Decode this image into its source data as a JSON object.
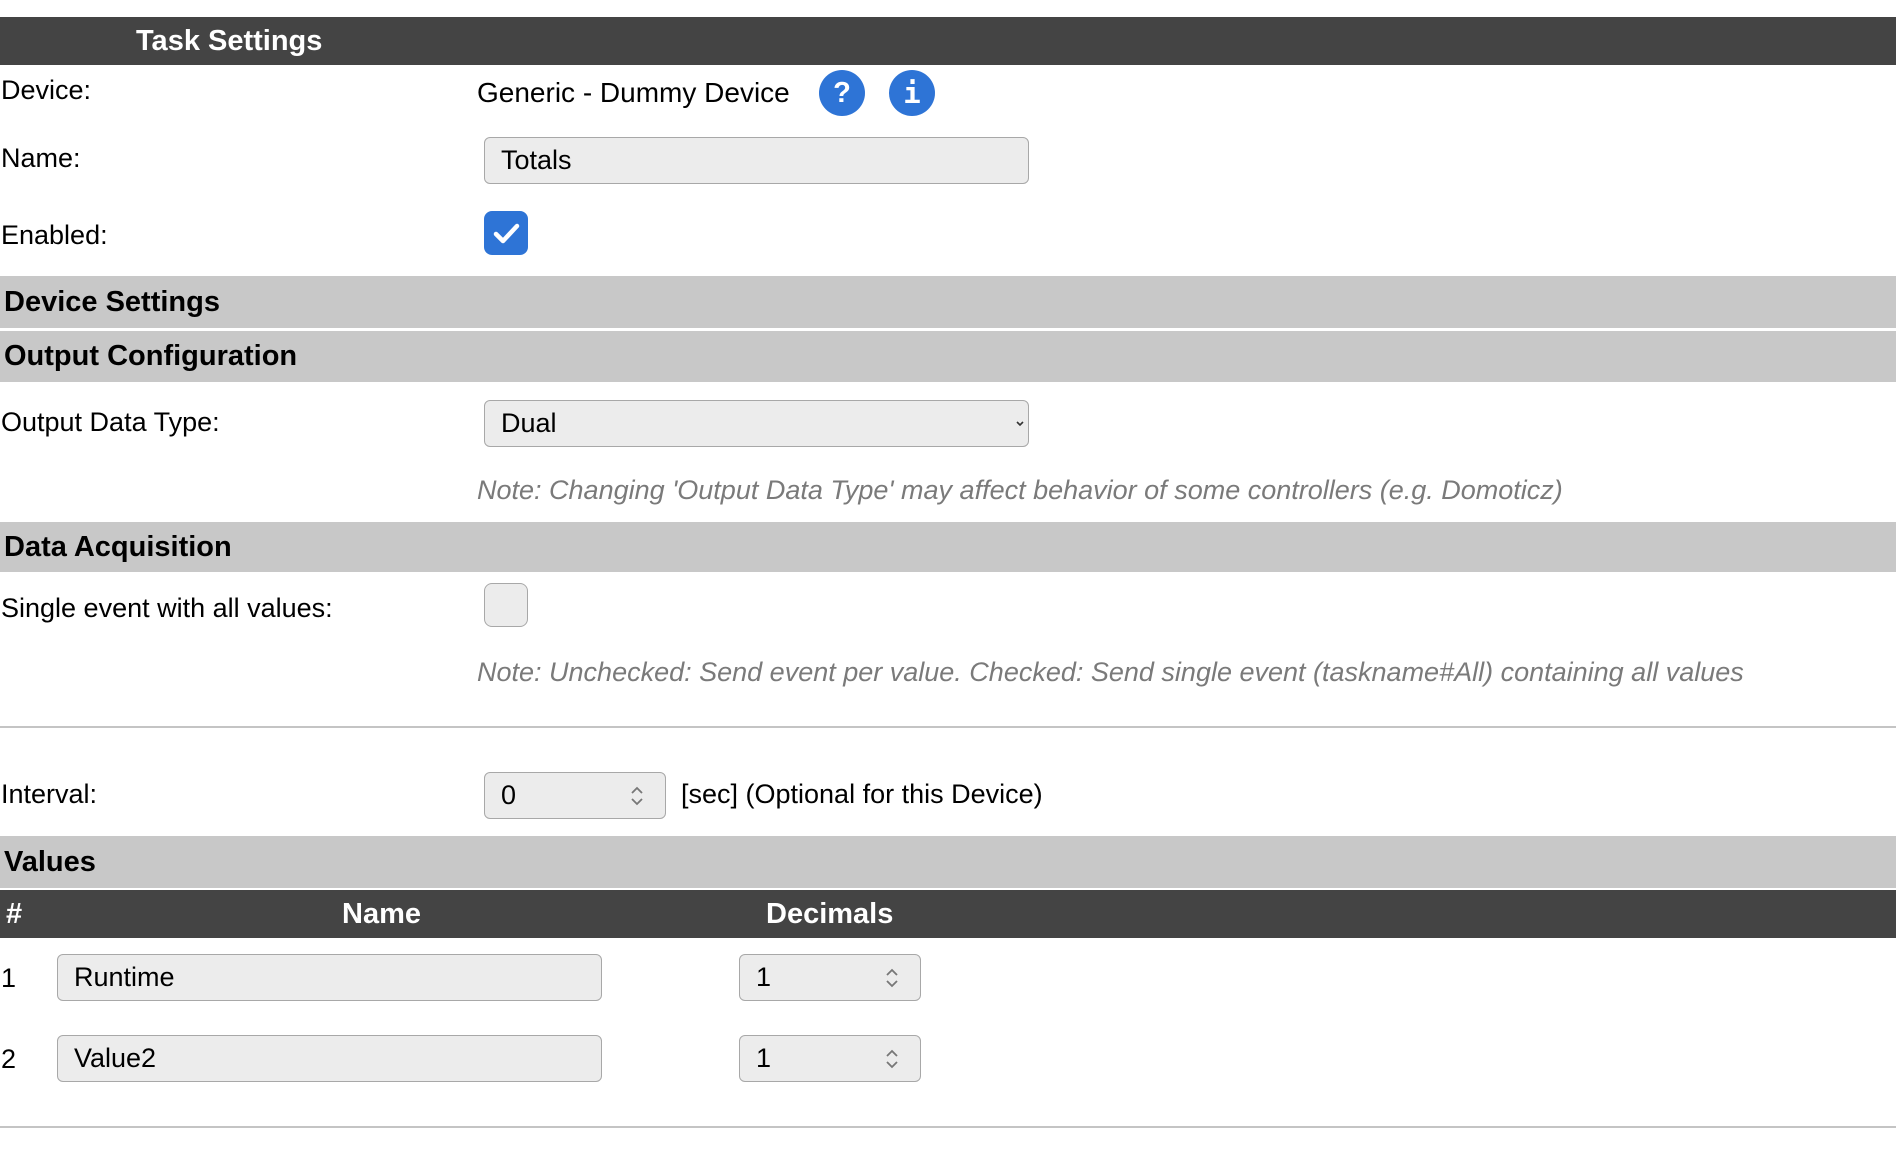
{
  "sections": {
    "task_settings": "Task Settings",
    "device_settings": "Device Settings",
    "output_configuration": "Output Configuration",
    "data_acquisition": "Data Acquisition",
    "values": "Values"
  },
  "device": {
    "label": "Device:",
    "value": "Generic - Dummy Device",
    "help_icon": "question-icon",
    "help_glyph": "?",
    "info_icon": "info-icon",
    "info_glyph": "i"
  },
  "name": {
    "label": "Name:",
    "value": "Totals"
  },
  "enabled": {
    "label": "Enabled:",
    "checked": true
  },
  "output_data_type": {
    "label": "Output Data Type:",
    "selected": "Dual",
    "note": "Note: Changing 'Output Data Type' may affect behavior of some controllers (e.g. Domoticz)"
  },
  "single_event": {
    "label": "Single event with all values:",
    "checked": false,
    "note": "Note: Unchecked: Send event per value. Checked: Send single event (taskname#All) containing all values"
  },
  "interval": {
    "label": "Interval:",
    "value": "0",
    "suffix": "[sec] (Optional for this Device)"
  },
  "values_table": {
    "headers": {
      "index": "#",
      "name": "Name",
      "decimals": "Decimals"
    },
    "rows": [
      {
        "index": "1",
        "name": "Runtime",
        "decimals": "1"
      },
      {
        "index": "2",
        "name": "Value2",
        "decimals": "1"
      }
    ]
  },
  "colors": {
    "header_dark": "#444444",
    "section_grey": "#c8c8c8",
    "accent_blue": "#2e74d6",
    "note_grey": "#7a7a7a"
  }
}
